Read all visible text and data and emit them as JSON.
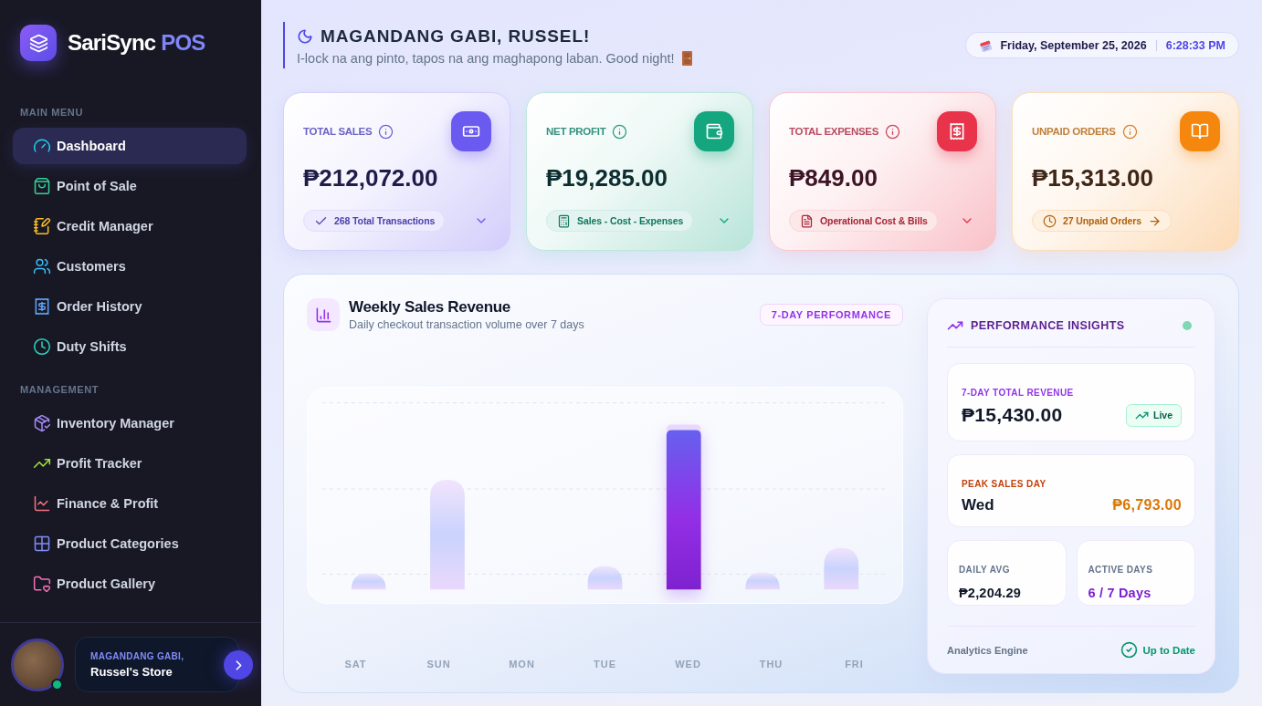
{
  "sidebar": {
    "brand": {
      "name": "SariSync",
      "suffix": "POS"
    },
    "sections": [
      {
        "heading": "MAIN MENU",
        "items": [
          {
            "label": "Dashboard",
            "selected": true,
            "color": "#22d3ee"
          },
          {
            "label": "Point of Sale",
            "selected": false,
            "color": "#34d399"
          },
          {
            "label": "Credit Manager",
            "selected": false,
            "color": "#fbbf24"
          },
          {
            "label": "Customers",
            "selected": false,
            "color": "#38bdf8"
          },
          {
            "label": "Order History",
            "selected": false,
            "color": "#60a5fa"
          },
          {
            "label": "Duty Shifts",
            "selected": false,
            "color": "#2dd4bf"
          }
        ]
      },
      {
        "heading": "MANAGEMENT",
        "items": [
          {
            "label": "Inventory Manager",
            "selected": false,
            "color": "#a78bfa"
          },
          {
            "label": "Profit Tracker",
            "selected": false,
            "color": "#a3e635"
          },
          {
            "label": "Finance & Profit",
            "selected": false,
            "color": "#fb7185"
          },
          {
            "label": "Product Categories",
            "selected": false,
            "color": "#818cf8"
          },
          {
            "label": "Product Gallery",
            "selected": false,
            "color": "#f472b6"
          }
        ]
      }
    ],
    "profile": {
      "greeting": "MAGANDANG GABI,",
      "store": "Russel's Store",
      "online": true
    }
  },
  "header": {
    "title": "MAGANDANG GABI, RUSSEL!",
    "subtitle": "I-lock na ang pinto, tapos na ang maghapong laban. Good night!",
    "date": "Friday, September 25, 2026",
    "time": "6:28:33 PM"
  },
  "stats": [
    {
      "label": "TOTAL SALES",
      "value": "₱212,072.00",
      "note": "268 Total Transactions",
      "kind": "expandable",
      "color": "#6a5af0"
    },
    {
      "label": "NET PROFIT",
      "value": "₱19,285.00",
      "note": "Sales - Cost - Expenses",
      "kind": "expandable",
      "color": "#13a67f"
    },
    {
      "label": "TOTAL EXPENSES",
      "value": "₱849.00",
      "note": "Operational Cost & Bills",
      "kind": "expandable",
      "color": "#e8334a"
    },
    {
      "label": "UNPAID ORDERS",
      "value": "₱15,313.00",
      "note": "27 Unpaid Orders",
      "kind": "link",
      "color": "#f5870f"
    }
  ],
  "weekly_sales": {
    "title": "Weekly Sales Revenue",
    "subtitle": "Daily checkout transaction volume over 7 days",
    "badge": "7-DAY PERFORMANCE",
    "days": [
      "SAT",
      "SUN",
      "MON",
      "TUE",
      "WED",
      "THU",
      "FRI"
    ]
  },
  "insights": {
    "title": "PERFORMANCE INSIGHTS",
    "online": true,
    "total": {
      "label": "7-DAY TOTAL REVENUE",
      "value": "₱15,430.00",
      "badge": "Live"
    },
    "peak": {
      "label": "PEAK SALES DAY",
      "day": "Wed",
      "value": "₱6,793.00"
    },
    "daily_avg": {
      "label": "DAILY AVG",
      "value": "₱2,204.29"
    },
    "active_days": {
      "label": "ACTIVE DAYS",
      "value": "6 / 7 Days"
    },
    "footer": {
      "label": "Analytics Engine",
      "status": "Up to Date"
    }
  }
}
